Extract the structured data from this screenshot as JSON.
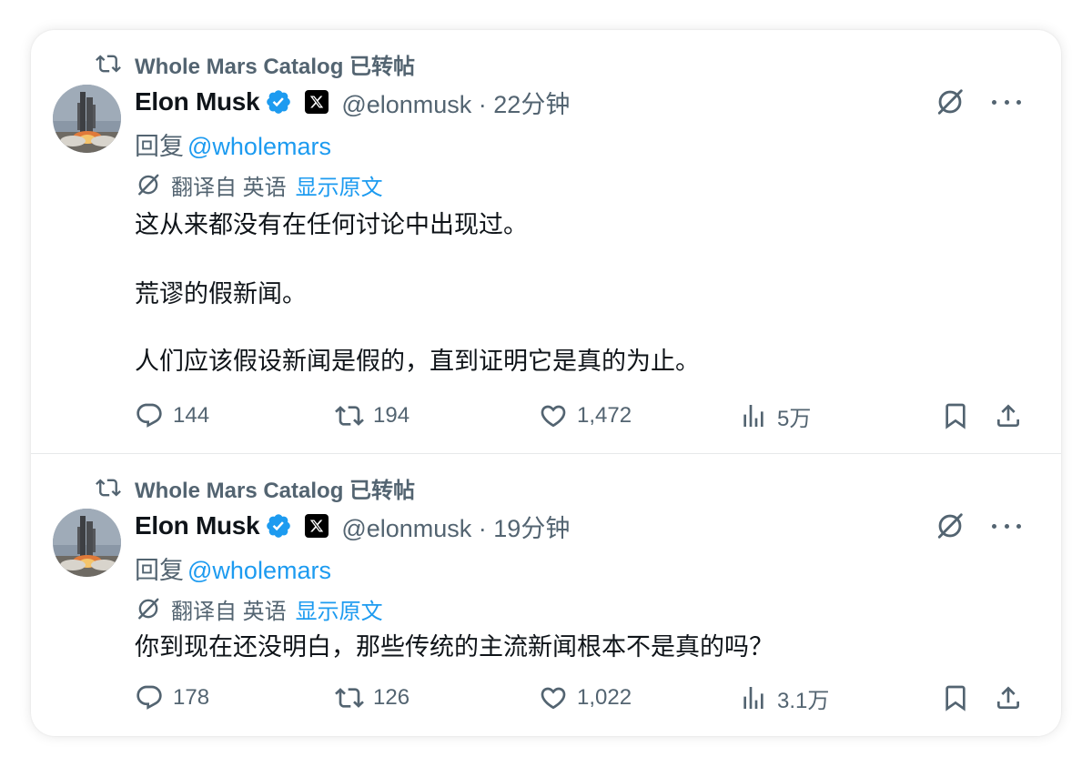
{
  "tweets": [
    {
      "repost_by": "Whole Mars Catalog 已转帖",
      "author_name": "Elon Musk",
      "handle_time": "@elonmusk · 22分钟",
      "reply_prefix": "回复",
      "reply_mention": "@wholemars",
      "translate_label": "翻译自 英语",
      "show_original": "显示原文",
      "paragraphs": [
        "这从来都没有在任何讨论中出现过。",
        "荒谬的假新闻。",
        "人们应该假设新闻是假的，直到证明它是真的为止。"
      ],
      "stats": {
        "replies": "144",
        "reposts": "194",
        "likes": "1,472",
        "views": "5万"
      }
    },
    {
      "repost_by": "Whole Mars Catalog 已转帖",
      "author_name": "Elon Musk",
      "handle_time": "@elonmusk · 19分钟",
      "reply_prefix": "回复",
      "reply_mention": "@wholemars",
      "translate_label": "翻译自 英语",
      "show_original": "显示原文",
      "paragraphs": [
        "你到现在还没明白，那些传统的主流新闻根本不是真的吗？"
      ],
      "stats": {
        "replies": "178",
        "reposts": "126",
        "likes": "1,022",
        "views": "3.1万"
      }
    }
  ],
  "icons": {
    "repost": "repost-icon",
    "verified": "verified-badge-icon",
    "affiliate": "x-logo-icon",
    "grok": "grok-icon",
    "more": "more-icon",
    "reply": "reply-icon",
    "like": "heart-icon",
    "views": "views-icon",
    "bookmark": "bookmark-icon",
    "share": "share-icon"
  },
  "colors": {
    "text": "#0f1419",
    "secondary": "#536471",
    "accent": "#1d9bf0"
  }
}
